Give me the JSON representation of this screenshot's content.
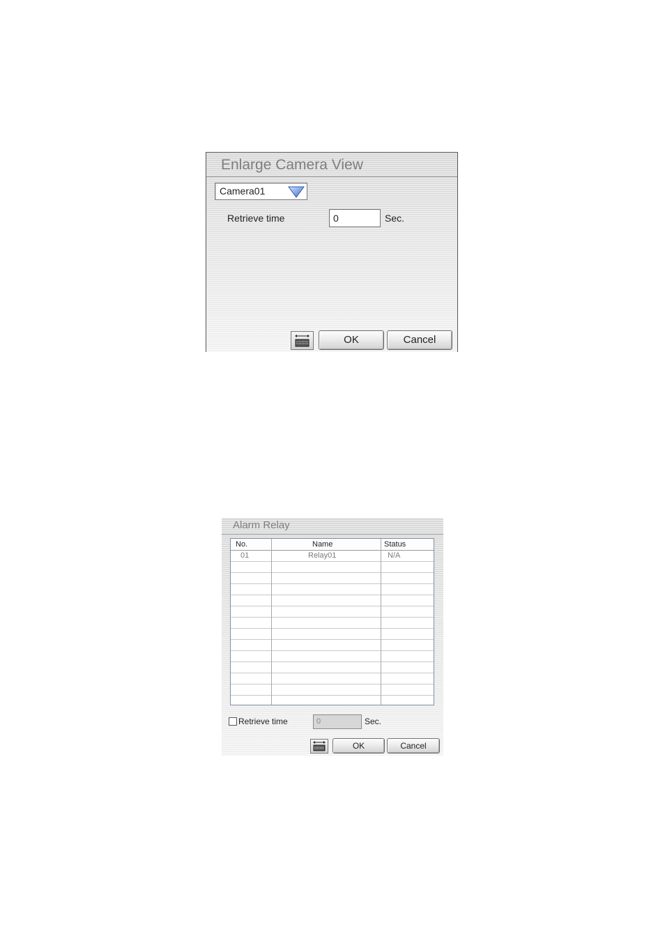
{
  "enlarge_dialog": {
    "title": "Enlarge Camera View",
    "camera_select": {
      "value": "Camera01"
    },
    "retrieve_label": "Retrieve time",
    "retrieve_value": "0",
    "unit": "Sec.",
    "ok_label": "OK",
    "cancel_label": "Cancel",
    "keyboard_icon": "keyboard-icon"
  },
  "alarm_dialog": {
    "title": "Alarm Relay",
    "columns": [
      "No.",
      "Name",
      "Status"
    ],
    "rows": [
      {
        "no": "01",
        "name": "Relay01",
        "status": "N/A"
      }
    ],
    "retrieve_label": "Retrieve time",
    "retrieve_checked": false,
    "retrieve_value": "0",
    "unit": "Sec.",
    "ok_label": "OK",
    "cancel_label": "Cancel",
    "keyboard_icon": "keyboard-icon"
  }
}
